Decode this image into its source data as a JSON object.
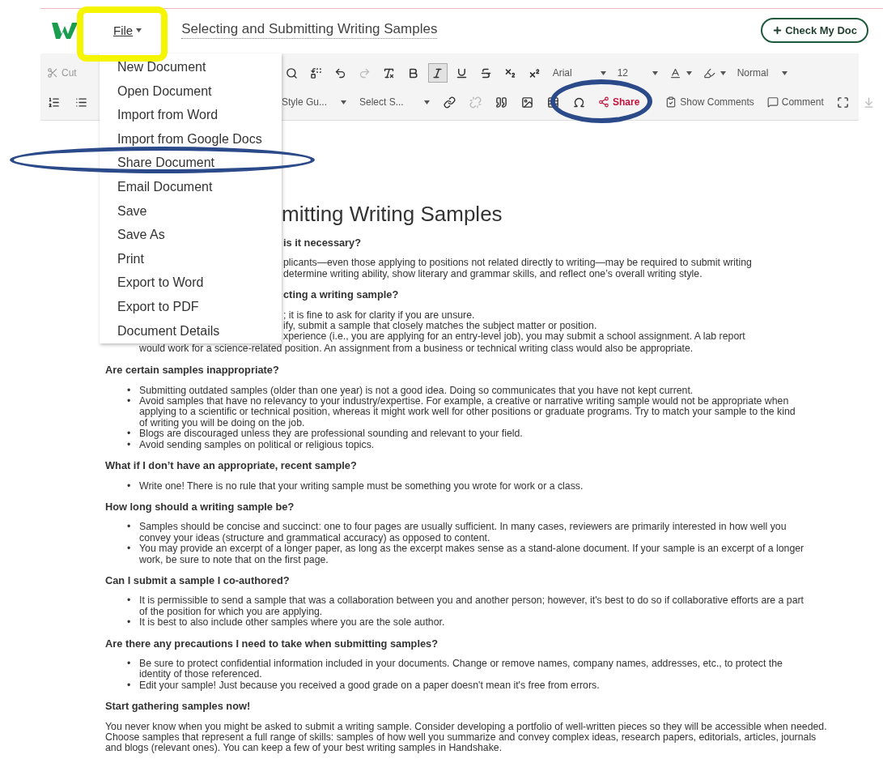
{
  "top_bar": {
    "file_label": "File",
    "document_title": "Selecting and Submitting Writing Samples",
    "check_button": "Check My Doc"
  },
  "toolbar": {
    "row_1": {
      "left": [
        {
          "kind": "labeled",
          "label": "Cut",
          "disabled": true,
          "emphasis": false
        }
      ],
      "right": [
        {
          "kind": "icon",
          "disabled": false
        },
        {
          "kind": "icon",
          "disabled": false
        },
        {
          "kind": "icon",
          "disabled": false
        },
        {
          "kind": "icon",
          "disabled": true
        },
        {
          "kind": "icon",
          "disabled": false
        },
        {
          "kind": "toggle",
          "selected": false
        },
        {
          "kind": "toggle",
          "selected": true
        },
        {
          "kind": "toggle",
          "selected": false
        },
        {
          "kind": "toggle",
          "selected": false
        },
        {
          "kind": "toggle",
          "selected": false
        },
        {
          "kind": "toggle",
          "selected": false
        },
        {
          "kind": "dropdown",
          "label": "Arial"
        },
        {
          "kind": "dropdown",
          "label": "12"
        },
        {
          "kind": "icon_dropdown"
        },
        {
          "kind": "icon_dropdown"
        },
        {
          "kind": "dropdown",
          "label": "Normal"
        }
      ]
    },
    "row_2": {
      "left": [
        {
          "kind": "icon",
          "disabled": false
        },
        {
          "kind": "icon",
          "disabled": false
        }
      ],
      "right": [
        {
          "kind": "dropdown",
          "label": "Style Gu..."
        },
        {
          "kind": "dropdown",
          "label": "Select S..."
        },
        {
          "kind": "icon",
          "disabled": false
        },
        {
          "kind": "icon",
          "disabled": true
        },
        {
          "kind": "icon",
          "disabled": false
        },
        {
          "kind": "icon",
          "disabled": false
        },
        {
          "kind": "icon",
          "disabled": false
        },
        {
          "kind": "icon",
          "disabled": false
        },
        {
          "kind": "labeled",
          "label": "Share",
          "disabled": false,
          "emphasis": true
        },
        {
          "kind": "labeled",
          "label": "Show Comments",
          "disabled": false,
          "emphasis": false
        },
        {
          "kind": "labeled",
          "label": "Comment",
          "disabled": false,
          "emphasis": false
        },
        {
          "kind": "icon",
          "disabled": false
        },
        {
          "kind": "icon",
          "disabled": true
        }
      ]
    }
  },
  "file_menu": {
    "items": [
      "New Document",
      "Open Document",
      "Import from Word",
      "Import from Google Docs",
      "Share Document",
      "Email Document",
      "Save",
      "Save As",
      "Print",
      "Export to Word",
      "Export to PDF",
      "Document Details"
    ]
  },
  "document": {
    "title": "mitting Writing Samples",
    "bullet_marker": "•",
    "covered_blocks": [
      {
        "kind": "heading",
        "text": "is it necessary?"
      },
      {
        "kind": "lines",
        "lines": [
          "plicants—even those applying to positions not related directly to writing—may be required to submit writing",
          "determine writing ability, show literary and grammar skills, and reflect one’s overall writing style."
        ]
      },
      {
        "kind": "heading",
        "text": "cting a writing sample?"
      },
      {
        "kind": "lines",
        "lines": [
          "; it is fine to ask for clarity if you are unsure.",
          "ify, submit a sample that closely matches the subject matter or position.",
          "xperience (i.e., you are applying for an entry-level job), you may submit a school assignment. A lab report"
        ]
      },
      {
        "kind": "tail",
        "text": "would work for a science-related position. An assignment from a business or technical writing class would also be appropriate."
      }
    ],
    "blocks": [
      {
        "kind": "heading",
        "text": "Are certain samples inappropriate?"
      },
      {
        "kind": "bullets",
        "items": [
          "Submitting outdated samples (older than one year) is not a good idea.  Doing so communicates that you have not kept current.",
          "Avoid samples that have no relevancy to your industry/expertise. For example, a creative or narrative writing sample would not be appropriate when applying to a scientific or technical position, whereas it might work well for other positions or graduate programs. Try to match your sample to the kind of writing you will be doing on the job.",
          "Blogs are discouraged unless they are professional sounding and relevant to your field.",
          "Avoid sending samples on political or religious topics."
        ]
      },
      {
        "kind": "heading",
        "text": "What if I don’t have an appropriate, recent sample?"
      },
      {
        "kind": "bullets",
        "items": [
          "Write one! There is no rule that your writing sample must be something you wrote for work or a class."
        ]
      },
      {
        "kind": "heading",
        "text": "How long should a writing sample be?"
      },
      {
        "kind": "bullets",
        "items": [
          "Samples should be concise and succinct: one to four pages are usually sufficient.  In many cases, reviewers are primarily interested in how well you convey your ideas (structure and grammatical accuracy) as opposed to content.",
          "You may provide an excerpt of a longer paper, as long as the excerpt makes sense as a stand-alone document. If your sample is an excerpt of a longer work, be sure to note that on the first page."
        ]
      },
      {
        "kind": "heading",
        "text": "Can I submit a sample I co-authored?"
      },
      {
        "kind": "bullets",
        "items": [
          "It is permissible to send a sample that was a collaboration between you and another person; however, it's best to do so if collaborative efforts are a part of the position for which you are applying.",
          "It is best to also include other samples where you are the sole author."
        ]
      },
      {
        "kind": "heading",
        "text": "Are there any precautions I need to take when submitting samples?"
      },
      {
        "kind": "bullets",
        "items": [
          "Be sure to protect confidential information included in your documents. Change or remove names, company names, addresses, etc., to protect the identity of those referenced.",
          "Edit your sample! Just because you received a good grade on a paper doesn't mean it's free from errors."
        ]
      },
      {
        "kind": "heading",
        "text": "Start gathering samples now!"
      },
      {
        "kind": "paragraph",
        "text": "You never know when you might be asked to submit a writing sample. Consider developing a portfolio of well-written pieces so they will be accessible when needed. Choose samples that represent a full range of skills: samples of how well you summarize and convey complex ideas, research papers, editorials, articles, journals and blogs (relevant ones). You can keep a few of your best writing samples in Handshake."
      }
    ]
  }
}
